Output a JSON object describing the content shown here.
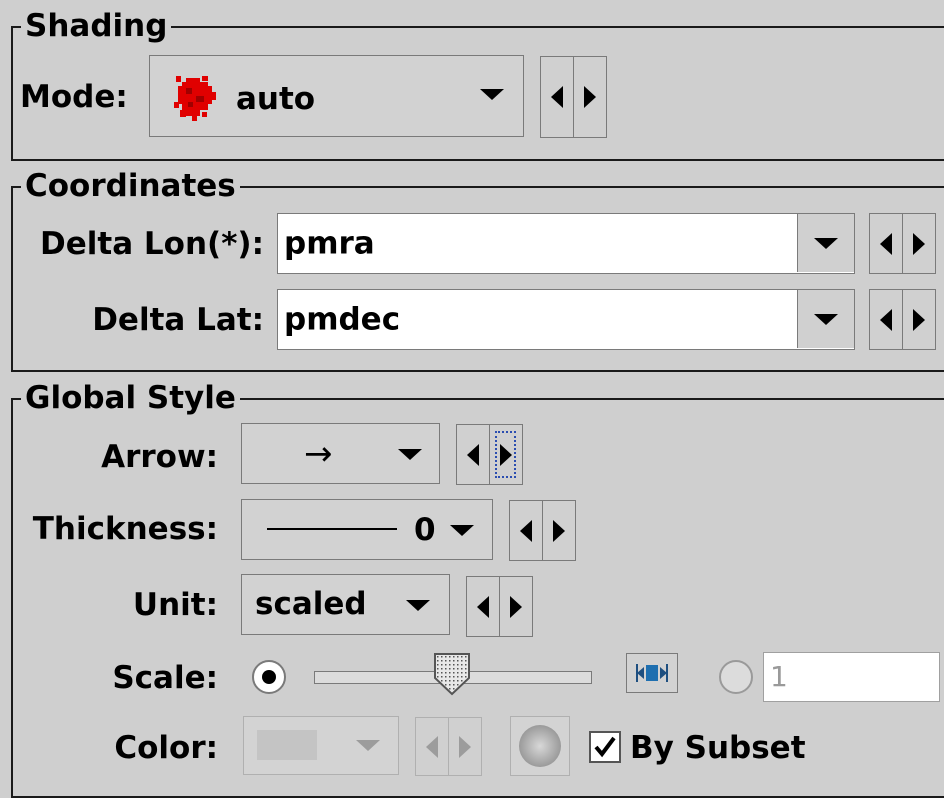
{
  "shading": {
    "legend": "Shading",
    "mode_label": "Mode:",
    "mode_value": "auto",
    "mode_icon": "red-splat-icon"
  },
  "coordinates": {
    "legend": "Coordinates",
    "delta_lon_label": "Delta Lon(*):",
    "delta_lon_value": "pmra",
    "delta_lat_label": "Delta Lat:",
    "delta_lat_value": "pmdec"
  },
  "global_style": {
    "legend": "Global Style",
    "arrow_label": "Arrow:",
    "arrow_value": "→",
    "thickness_label": "Thickness:",
    "thickness_value": "0",
    "unit_label": "Unit:",
    "unit_value": "scaled",
    "scale_label": "Scale:",
    "scale_slider_fraction": 0.5,
    "scale_slider_selected": true,
    "scale_text_selected": false,
    "scale_text_value": "1",
    "color_label": "Color:",
    "by_subset_label": "By Subset",
    "by_subset_checked": true
  },
  "colors": {
    "panel_bg": "#cfcfcf",
    "mode_icon_red": "#e00000"
  }
}
